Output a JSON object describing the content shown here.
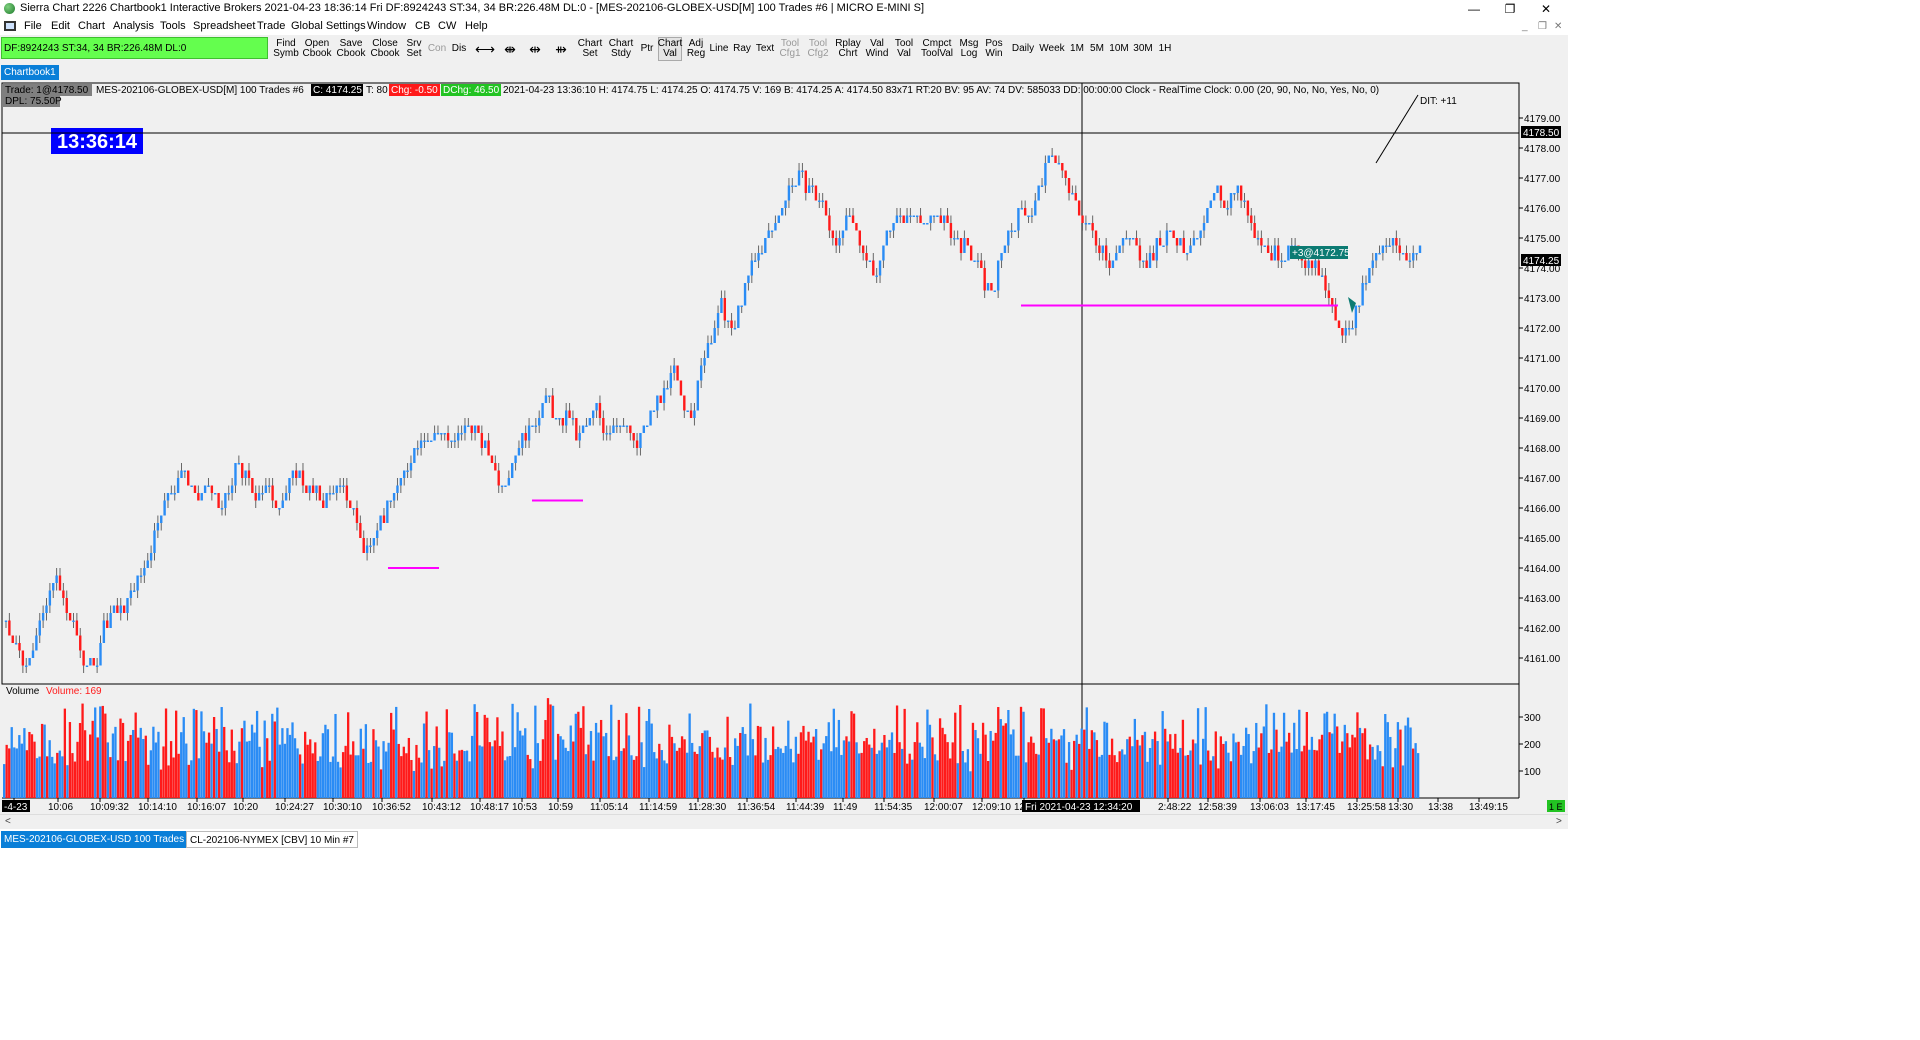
{
  "window": {
    "title": "Sierra Chart 2226 Chartbook1  Interactive Brokers 2021-04-23  18:36:14 Fri  DF:8924243  ST:34, 34  BR:226.48M  DL:0 - [MES-202106-GLOBEX-USD[M]  100 Trades  #6 | MICRO E-MINI S]",
    "minimize": "—",
    "restore": "❐",
    "close": "✕",
    "mdi_minimize": "_",
    "mdi_restore": "❐",
    "mdi_close": "✕"
  },
  "menu": [
    "File",
    "Edit",
    "Chart",
    "Analysis",
    "Tools",
    "Spreadsheet",
    "Trade",
    "Global Settings",
    "Window",
    "CB",
    "CW",
    "Help"
  ],
  "status_bar": {
    "text": "DF:8924243  ST:34, 34  BR:226.48M  DL:0",
    "color": "#64fe4e"
  },
  "toolbar": [
    {
      "l1": "Find",
      "l2": "Symb",
      "name": "find-symbol-button"
    },
    {
      "l1": "Open",
      "l2": "Cbook",
      "name": "open-chartbook-button"
    },
    {
      "l1": "Save",
      "l2": "Cbook",
      "name": "save-chartbook-button"
    },
    {
      "l1": "Close",
      "l2": "Cbook",
      "name": "close-chartbook-button"
    },
    {
      "l1": "Srv",
      "l2": "Set",
      "name": "server-settings-button"
    },
    {
      "l1": "Con",
      "l2": "",
      "name": "connect-button",
      "disabled": true
    },
    {
      "l1": "Dis",
      "l2": "",
      "name": "disconnect-button"
    },
    {
      "icon": "⟷",
      "name": "scale-horizontal-button"
    },
    {
      "icon": "⇼",
      "name": "scale-fit-button"
    },
    {
      "icon": "⇹",
      "name": "scroll-left-button"
    },
    {
      "icon": "⇻",
      "name": "scroll-right-button"
    },
    {
      "l1": "Chart",
      "l2": "Set",
      "name": "chart-settings-button"
    },
    {
      "l1": "Chart",
      "l2": "Stdy",
      "name": "chart-studies-button"
    },
    {
      "l1": "Ptr",
      "l2": "",
      "name": "pointer-tool-button"
    },
    {
      "l1": "Chart",
      "l2": "Val",
      "name": "chart-values-button",
      "pressed": true
    },
    {
      "l1": "Adj",
      "l2": "Reg",
      "name": "adjust-region-button"
    },
    {
      "l1": "Line",
      "l2": "",
      "name": "line-tool-button"
    },
    {
      "l1": "Ray",
      "l2": "",
      "name": "ray-tool-button"
    },
    {
      "l1": "Text",
      "l2": "",
      "name": "text-tool-button"
    },
    {
      "l1": "Tool",
      "l2": "Cfg1",
      "name": "tool-config1-button",
      "disabled": true
    },
    {
      "l1": "Tool",
      "l2": "Cfg2",
      "name": "tool-config2-button",
      "disabled": true
    },
    {
      "l1": "Rplay",
      "l2": "Chrt",
      "name": "replay-chart-button"
    },
    {
      "l1": "Val",
      "l2": "Wind",
      "name": "values-window-button"
    },
    {
      "l1": "Tool",
      "l2": "Val",
      "name": "tool-values-button"
    },
    {
      "l1": "Cmpct",
      "l2": "ToolVal",
      "name": "compact-tool-values-button"
    },
    {
      "l1": "Msg",
      "l2": "Log",
      "name": "message-log-button"
    },
    {
      "l1": "Pos",
      "l2": "Win",
      "name": "positions-window-button"
    },
    {
      "l1": "Daily",
      "l2": "",
      "name": "daily-button"
    },
    {
      "l1": "Week",
      "l2": "",
      "name": "week-button"
    },
    {
      "l1": "1M",
      "l2": "",
      "name": "1m-button"
    },
    {
      "l1": "5M",
      "l2": "",
      "name": "5m-button"
    },
    {
      "l1": "10M",
      "l2": "",
      "name": "10m-button"
    },
    {
      "l1": "30M",
      "l2": "",
      "name": "30m-button"
    },
    {
      "l1": "1H",
      "l2": "",
      "name": "1h-button"
    }
  ],
  "chartbook_tab": "Chartbook1",
  "chart_header": {
    "trade": "Trade: 1@4178.50",
    "symbol": "MES-202106-GLOBEX-USD[M]  100 Trades  #6",
    "close": "C: 4174.25",
    "trades": "T: 80",
    "chg": "Chg: -0.50",
    "dchg": "DChg: 46.50",
    "rest": "2021-04-23 13:36:10 H: 4174.75 L: 4174.25 O: 4174.75 V: 169 B: 4174.25 A: 4174.50 83x71 RT:20 BV: 95 AV: 74 DV: 585033 DD: 00:00:00 Clock - RealTime  Clock: 0.00   (20, 90, No, No, Yes, No, 0)",
    "dpl": "DPL: 75.50P",
    "dit": "DIT: +11"
  },
  "clock": "13:36:14",
  "position_label": "+3@4172.75",
  "price_marker_top": "4178.50",
  "price_marker_last": "4174.25",
  "crosshair_date": "Fri 2021-04-23  12:34:20",
  "volume_header": {
    "label": "Volume",
    "value": "Volume: 169"
  },
  "volume_ticks": [
    "300",
    "200",
    "100"
  ],
  "x_labels": [
    "-4-23",
    "10:06",
    "10:09:32",
    "10:14:10",
    "10:16:07",
    "10:20",
    "10:24:27",
    "10:30:10",
    "10:36:52",
    "10:43:12",
    "10:48:17",
    "10:53",
    "10:59",
    "11:05:14",
    "11:14:59",
    "11:28:30",
    "11:36:54",
    "11:44:39",
    "11:49",
    "11:54:35",
    "12:00:07",
    "12:09:10",
    "12:2",
    "2:48:22",
    "12:58:39",
    "13:06:03",
    "13:17:45",
    "13:25:58",
    "13:30",
    "13:38",
    "13:49:15"
  ],
  "corner_badge": "1 E",
  "scroll_left": "<",
  "scroll_right": ">",
  "bottom_tabs": [
    {
      "label": "MES-202106-GLOBEX-USD  100 Trades  #6",
      "active": true
    },
    {
      "label": "CL-202106-NYMEX [CBV]  10 Min   #7",
      "active": false
    }
  ],
  "colors": {
    "up": "#2a8cf5",
    "down": "#ff1a1a",
    "support": "#ff00ff",
    "clock_bg": "#0000ff"
  },
  "chart_data": {
    "type": "line",
    "title": "MES-202106-GLOBEX-USD[M]  100 Trades  #6",
    "xlabel": "",
    "ylabel": "",
    "y_ticks": [
      4179,
      4178,
      4177,
      4176,
      4175,
      4174,
      4173,
      4172,
      4171,
      4170,
      4169,
      4168,
      4167,
      4166,
      4165,
      4164,
      4163,
      4162,
      4161
    ],
    "ylim": [
      4160.25,
      4179.75
    ],
    "price_path": [
      4162.25,
      4161.5,
      4160.75,
      4161.75,
      4162.5,
      4163.75,
      4162.75,
      4162,
      4161,
      4160.5,
      4162,
      4162.75,
      4162.5,
      4163.25,
      4163.75,
      4164.75,
      4166,
      4166.5,
      4167.25,
      4166.75,
      4166.25,
      4166.75,
      4166,
      4166.5,
      4167.5,
      4166.75,
      4166.5,
      4166.75,
      4166,
      4166.5,
      4167.25,
      4166.75,
      4166.5,
      4166.25,
      4166.75,
      4166.5,
      4165.75,
      4164.5,
      4165.25,
      4165.75,
      4166.5,
      4167,
      4167.75,
      4168.5,
      4168.25,
      4168.75,
      4168,
      4168.5,
      4168.75,
      4168.25,
      4167.75,
      4166.75,
      4167.25,
      4168.25,
      4168.5,
      4169.25,
      4169.75,
      4168.75,
      4169.25,
      4168.25,
      4168.75,
      4169.25,
      4168.5,
      4169,
      4168.75,
      4168,
      4168.75,
      4169.5,
      4169.75,
      4170.5,
      4169.5,
      4169.25,
      4171,
      4172,
      4172.75,
      4171.75,
      4173,
      4174,
      4174.75,
      4175.25,
      4176,
      4176.75,
      4177,
      4176.75,
      4176.25,
      4175.5,
      4174.75,
      4175.75,
      4175,
      4174.25,
      4173.75,
      4175.25,
      4175.75,
      4175.5,
      4176,
      4175.25,
      4175.75,
      4175.5,
      4175,
      4174.75,
      4174.25,
      4173.5,
      4173.25,
      4174.75,
      4175.5,
      4176,
      4175.75,
      4177,
      4178,
      4177.25,
      4176.5,
      4175.75,
      4175.25,
      4174.75,
      4174.25,
      4174.75,
      4175,
      4174.5,
      4174.25,
      4174.75,
      4175.25,
      4175,
      4174.25,
      4175.25,
      4175.75,
      4176.5,
      4176.25,
      4176.75,
      4176,
      4175.25,
      4174.75,
      4174.5,
      4174.25,
      4174.75,
      4173.75,
      4174.25,
      4173.5,
      4172.5,
      4171.75,
      4172.25,
      4173.25,
      4174.25,
      4174.75,
      4175,
      4174.5,
      4174.25,
      4174.75
    ],
    "volume_series": [
      {
        "name": "Volume",
        "summary": "alternating up/down volume bars",
        "values": [
          180,
          220,
          160,
          250,
          210,
          190,
          270,
          230,
          200,
          175,
          240,
          260,
          215,
          185,
          225,
          300,
          250,
          195,
          210,
          230
        ]
      }
    ],
    "support_lines": [
      {
        "y": 4164,
        "x_range": [
          "10:41",
          "10:45"
        ]
      },
      {
        "y": 4166.25,
        "x_range": [
          "10:57",
          "11:00"
        ]
      },
      {
        "y": 4172.75,
        "x_range": [
          "12:20",
          "13:22"
        ]
      }
    ],
    "legend": "none",
    "grid": false
  }
}
